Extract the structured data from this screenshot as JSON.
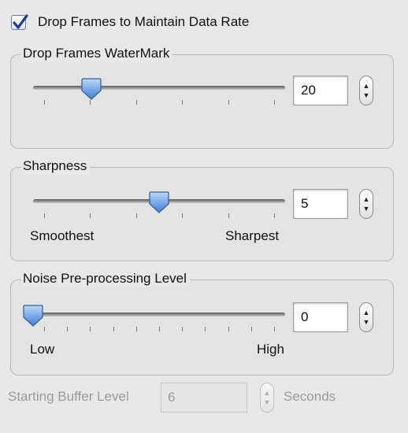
{
  "drop_frames": {
    "label": "Drop Frames to Maintain Data Rate",
    "checked": true
  },
  "watermark": {
    "title": "Drop Frames WaterMark",
    "value": "20",
    "slider_fraction": 0.23,
    "tick_count": 6
  },
  "sharpness": {
    "title": "Sharpness",
    "value": "5",
    "slider_fraction": 0.5,
    "tick_count": 6,
    "min_label": "Smoothest",
    "max_label": "Sharpest"
  },
  "noise": {
    "title": "Noise Pre-processing Level",
    "value": "0",
    "slider_fraction": 0.0,
    "tick_count": 11,
    "min_label": "Low",
    "max_label": "High"
  },
  "buffer": {
    "label": "Starting Buffer Level",
    "value": "6",
    "unit": "Seconds",
    "enabled": false
  },
  "icons": {
    "check": "checkmark-icon",
    "thumb": "slider-thumb-icon",
    "stepper": "stepper-arrows-icon"
  },
  "colors": {
    "check": "#1a3f8f",
    "thumb": "#4f8fe0"
  }
}
